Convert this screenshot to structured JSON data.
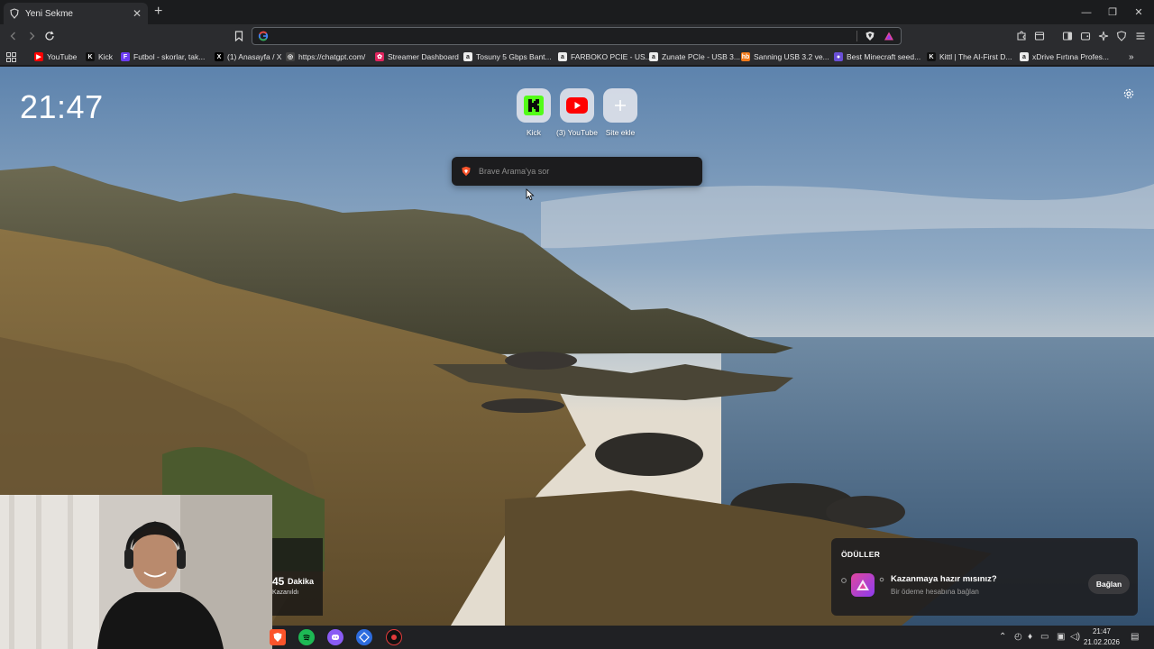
{
  "tab": {
    "title": "Yeni Sekme",
    "close": "✕",
    "new_tab": "+"
  },
  "window": {
    "minimize": "—",
    "restore": "❐",
    "close": "✕"
  },
  "toolbar": {
    "url_value": "",
    "search_engine": "google-icon"
  },
  "bookmarks": [
    {
      "label": "YouTube",
      "icon": "youtube-icon",
      "color": "#ff0000",
      "glyph": "▶"
    },
    {
      "label": "Kick",
      "icon": "kick-icon",
      "color": "#111111",
      "glyph": "K"
    },
    {
      "label": "Futbol - skorlar, tak...",
      "icon": "futbol-icon",
      "color": "#6d3cf5",
      "glyph": "F"
    },
    {
      "label": "(1) Anasayfa / X",
      "icon": "x-icon",
      "color": "#000000",
      "glyph": "X"
    },
    {
      "label": "https://chatgpt.com/",
      "icon": "chatgpt-icon",
      "color": "#444444",
      "glyph": "◎"
    },
    {
      "label": "Streamer Dashboard",
      "icon": "streamer-icon",
      "color": "#e0245e",
      "glyph": "✿"
    },
    {
      "label": "Tosuny 5 Gbps Bant...",
      "icon": "amazon-icon",
      "color": "#ececec",
      "glyph": "a"
    },
    {
      "label": "FARBOKO PCIE - US...",
      "icon": "amazon-icon",
      "color": "#ececec",
      "glyph": "a"
    },
    {
      "label": "Zunate PCIe - USB 3...",
      "icon": "amazon-icon",
      "color": "#ececec",
      "glyph": "a"
    },
    {
      "label": "Sanning USB 3.2 ve...",
      "icon": "hb-icon",
      "color": "#f27a1a",
      "glyph": "hb"
    },
    {
      "label": "Best Minecraft seed...",
      "icon": "minecraft-icon",
      "color": "#6a4fd6",
      "glyph": "●"
    },
    {
      "label": "Kittl | The AI-First D...",
      "icon": "kittl-icon",
      "color": "#111111",
      "glyph": "K"
    },
    {
      "label": "xDrive Fırtına Profes...",
      "icon": "amazon-icon",
      "color": "#ececec",
      "glyph": "a"
    }
  ],
  "ntp": {
    "clock": "21:47",
    "top_sites": [
      {
        "label": "Kick",
        "icon": "kick-icon"
      },
      {
        "label": "(3) YouTube",
        "icon": "youtube-icon"
      },
      {
        "label": "Site ekle",
        "icon": "plus-icon"
      }
    ],
    "search_placeholder": "Brave Arama'ya sor"
  },
  "rewards": {
    "title": "ÖDÜLLER",
    "heading": "Kazanmaya hazır mısınız?",
    "subtitle": "Bir ödeme hesabına bağlan",
    "button": "Bağlan"
  },
  "stream_timer": {
    "value": "45",
    "unit": "Dakika",
    "caption": "Kazanıldı"
  },
  "taskbar": {
    "time": "21:47",
    "date": "21.02.2026"
  },
  "colors": {
    "brave_orange": "#fb542b",
    "kick_green": "#53fc18",
    "youtube_red": "#ff0000"
  }
}
